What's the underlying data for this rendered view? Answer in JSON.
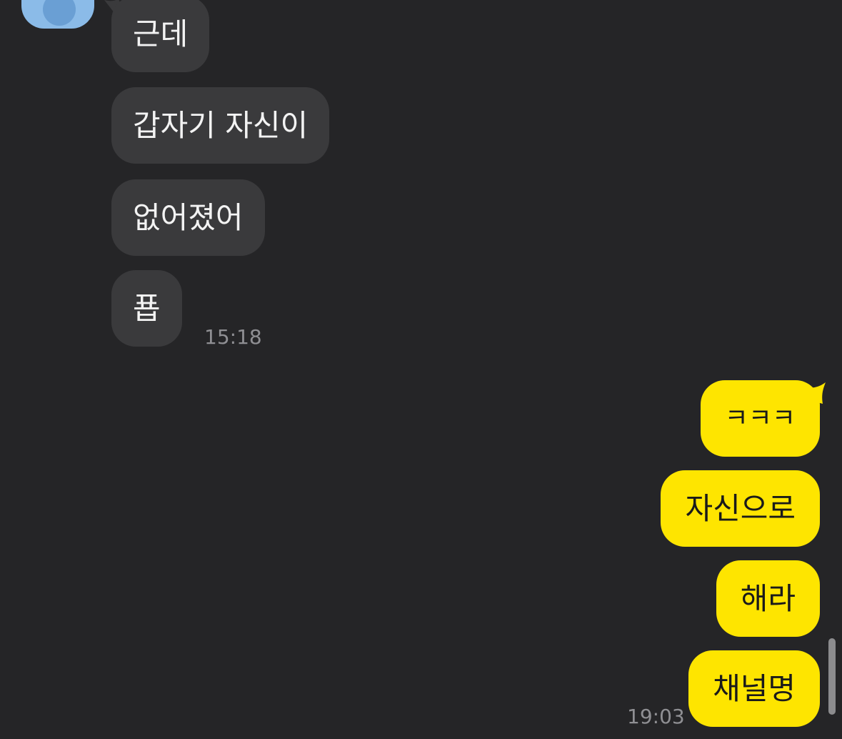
{
  "chat": {
    "incoming": [
      {
        "text": "근데"
      },
      {
        "text": "갑자기 자신이"
      },
      {
        "text": "없어졌어"
      },
      {
        "text": "푭"
      }
    ],
    "incoming_time": "15:18",
    "outgoing": [
      {
        "text": "ㅋㅋㅋ"
      },
      {
        "text": "자신으로"
      },
      {
        "text": "해라"
      },
      {
        "text": "채널명"
      }
    ],
    "outgoing_time": "19:03"
  },
  "colors": {
    "background": "#252527",
    "incoming_bubble": "#3a3a3c",
    "outgoing_bubble": "#fee500",
    "avatar": "#8bbbe8"
  }
}
